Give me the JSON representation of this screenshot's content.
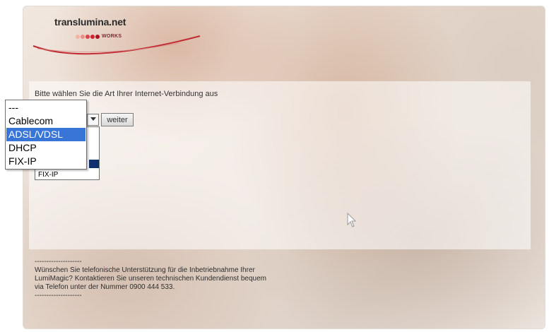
{
  "logo": {
    "name": "translumina.net",
    "tagline": "WORKS",
    "dot_colors": [
      "#f4b3a2",
      "#ef8c83",
      "#e0414e",
      "#d12233",
      "#b01125"
    ]
  },
  "form": {
    "prompt": "Bitte wählen Sie die Art Ihrer Internet-Verbindung aus",
    "submit_label": "weiter",
    "listbox_last_item": "FIX-IP"
  },
  "dropdown": {
    "options": [
      "---",
      "Cablecom",
      "ADSL/VDSL",
      "DHCP",
      "FIX-IP"
    ],
    "highlighted": "ADSL/VDSL",
    "highlight_color": "#3875d7"
  },
  "footer": {
    "separator": "--------------------",
    "lines": [
      "Wünschen Sie telefonische Unterstützung für die Inbetriebnahme Ihrer",
      "LumiMagic? Kontaktieren Sie unseren technischen Kundendienst bequem",
      "via Telefon unter der Nummer 0900 444 533."
    ]
  },
  "icons": [
    "select-arrow-icon",
    "mouse-cursor-icon"
  ]
}
